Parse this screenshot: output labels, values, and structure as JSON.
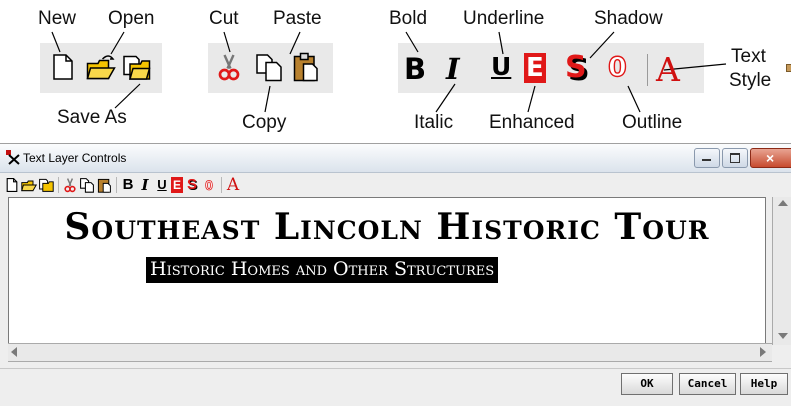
{
  "callouts": {
    "new": "New",
    "open": "Open",
    "save_as": "Save As",
    "cut": "Cut",
    "copy": "Copy",
    "paste": "Paste",
    "bold": "Bold",
    "italic": "Italic",
    "underline": "Underline",
    "enhanced": "Enhanced",
    "shadow": "Shadow",
    "outline": "Outline",
    "text_style_line1": "Text",
    "text_style_line2": "Style"
  },
  "icons": {
    "new": "new-document-icon",
    "open": "open-folder-icon",
    "save_as": "save-as-icon",
    "cut": "scissors-icon",
    "copy": "copy-icon",
    "paste": "paste-clipboard-icon",
    "bold": "bold-icon",
    "italic": "italic-icon",
    "underline": "underline-icon",
    "enhanced": "enhanced-icon",
    "shadow": "shadow-icon",
    "outline": "outline-icon",
    "text_style": "text-style-icon"
  },
  "glyphs": {
    "bold": "B",
    "italic": "I",
    "underline": "U",
    "enhanced": "E",
    "shadow": "S",
    "outline": "0",
    "text_style": "A"
  },
  "colors": {
    "enhanced_red": "#e01818",
    "text_style_red": "#d01010",
    "folder_yellow": "#f5c400",
    "paste_brown": "#b8812e"
  },
  "window": {
    "title": "Text Layer Controls",
    "app_icon": "tntmips-app-icon"
  },
  "canvas": {
    "title": "Southeast Lincoln Historic Tour",
    "subtitle": "Historic Homes and Other Structures"
  },
  "buttons": {
    "ok": "OK",
    "cancel": "Cancel",
    "help": "Help"
  }
}
